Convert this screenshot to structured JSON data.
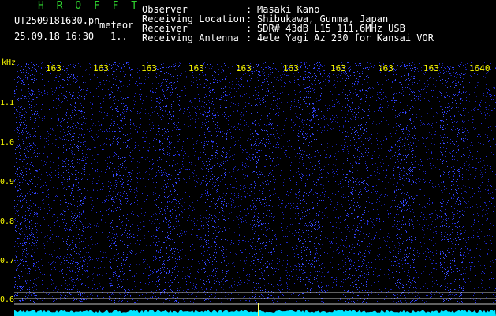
{
  "header": {
    "brand": "H R O F F T",
    "filename": "UT2509181630.pn",
    "tag": "meteor",
    "datetime": "25.09.18 16:30",
    "count": "1.."
  },
  "meta": [
    {
      "label": "Observer",
      "value": "Masaki Kano"
    },
    {
      "label": "Receiving Location",
      "value": "Shibukawa, Gunma, Japan"
    },
    {
      "label": "Receiver",
      "value": "SDR# 43dB L15 111.6MHz USB"
    },
    {
      "label": "Receiving Antenna",
      "value": "4ele Yagi Az 230 for Kansai VOR"
    }
  ],
  "meta_sep": ":",
  "spectrogram": {
    "y_unit": "kHz",
    "y_ticks": [
      "1.1",
      "1.0",
      "0.9",
      "0.8",
      "0.7",
      "0.6"
    ],
    "x_ticks": [
      "163",
      "163",
      "163",
      "163",
      "163",
      "163",
      "163",
      "163",
      "163",
      "1640"
    ],
    "colors": {
      "background": "#000000",
      "noise": "#1e2bd6",
      "trace": "#00e5ff",
      "axis": "#ffff00",
      "line": "#ffffff"
    }
  }
}
